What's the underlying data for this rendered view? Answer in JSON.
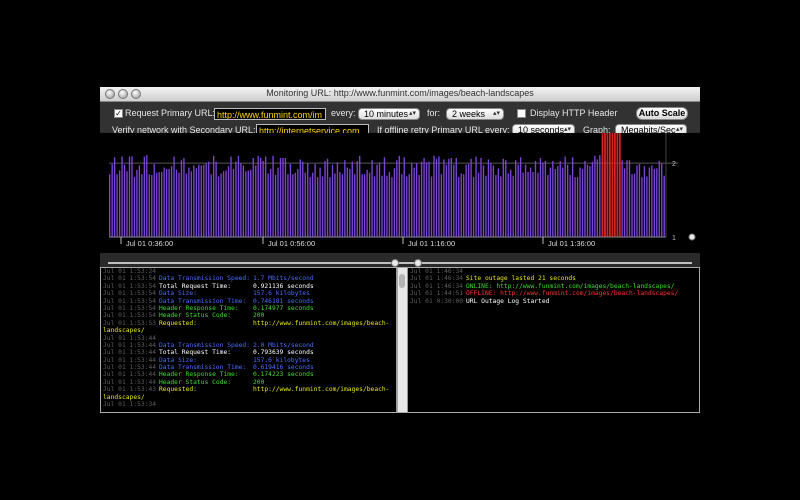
{
  "window": {
    "title": "Monitoring URL: http://www.funmint.com/images/beach-landscapes"
  },
  "controls": {
    "request_primary_checked": "✓",
    "request_primary_label": "Request Primary URL:",
    "primary_url": "http://www.funmint.com/im",
    "every_label": "every:",
    "every_value": "10 minutes",
    "for_label": "for:",
    "for_value": "2 weeks",
    "http_header_label": "Display HTTP Header",
    "auto_scale": "Auto Scale",
    "secondary_label": "Verify network with Secondary URL:",
    "secondary_url": "http://internetservice.com",
    "retry_label": "If offline retry Primary URL every:",
    "retry_value": "10 seconds",
    "graph_label": "Graph:",
    "graph_value": "Megabits/Sec"
  },
  "colors": {
    "bar": "#7b44d8",
    "outage": "#d8231e",
    "text_green": "#3fdc2f",
    "text_blue": "#4a6bff",
    "text_white": "#ffffff",
    "text_yellow": "#e6e619",
    "text_red": "#ff3030",
    "timestamp": "#5e5e5e"
  },
  "chart_data": {
    "type": "bar",
    "y_ticks": [
      "2",
      "1"
    ],
    "x_ticks": [
      "Jul 01 0:36:00",
      "Jul 01 0:56:00",
      "Jul 01 1:16:00",
      "Jul 01 1:36:00"
    ],
    "series": [
      {
        "values": [
          1.85,
          1.99,
          2.08,
          1.85,
          1.9,
          2.09,
          1.98,
          1.89,
          2.09,
          2.09,
          1.81,
          1.91,
          1.97,
          1.85,
          2.09,
          2.11,
          1.85,
          1.84,
          1.99,
          1.87,
          1.88,
          1.88,
          1.94,
          1.92,
          1.92,
          1.96,
          2.09,
          1.91,
          1.87,
          2.04,
          2.07,
          1.86,
          1.94,
          1.89,
          1.97,
          1.93,
          1.98,
          1.97,
          1.98,
          2.0,
          2.02,
          1.85,
          2.1,
          2.02,
          1.82,
          1.86,
          1.89,
          1.9,
          1.96,
          2.09,
          1.92,
          2.02,
          2.1,
          2.0,
          1.97,
          1.89,
          1.9,
          1.91,
          2.07,
          1.97,
          2.1,
          2.07,
          2.03,
          2.09,
          1.86,
          1.92,
          2.1,
          1.84,
          1.94,
          2.07,
          2.07,
          2.07,
          1.85,
          1.99,
          1.85,
          1.87,
          1.92,
          2.05,
          2.02,
          1.87,
          2.0,
          1.81,
          1.87,
          1.99,
          1.81,
          1.94,
          1.82,
          2.03,
          2.06,
          1.81,
          1.98,
          1.86,
          2.01,
          1.88,
          1.85,
          2.04,
          1.94,
          1.92,
          2.02,
          1.85,
          2.03,
          2.1,
          1.85,
          1.85,
          1.91,
          1.87,
          2.04,
          1.82,
          1.98,
          2.01,
          1.83,
          2.08,
          1.83,
          1.88,
          1.81,
          1.93,
          2.04,
          2.1,
          1.85,
          2.08,
          1.82,
          1.85,
          2.0,
          1.94,
          2.0,
          1.84,
          2.02,
          2.07,
          2.01,
          2.02,
          1.82,
          2.1,
          2.06,
          2.09,
          1.85,
          2.05,
          1.98,
          2.06,
          2.07,
          1.98,
          2.07,
          1.81,
          1.86,
          1.85,
          1.98,
          1.99,
          2.06,
          1.81,
          2.09,
          1.87,
          2.07,
          1.97,
          1.83,
          2.05,
          2.0,
          1.97,
          1.84,
          1.93,
          1.82,
          2.06,
          2.04,
          1.86,
          1.91,
          1.83,
          2.04,
          1.98,
          2.08,
          1.87,
          1.98,
          1.88,
          1.94,
          1.88,
          2.03,
          1.87,
          2.07,
          2.01,
          2.03,
          1.84,
          1.94,
          2.03,
          1.92,
          1.96,
          2.03,
          1.94,
          2.09,
          1.98,
          1.84,
          2.08,
          1.81,
          1.81,
          1.94,
          1.92,
          2.03,
          1.98,
          1.96,
          2.02,
          2.1,
          2.05,
          2.11,
          2.07,
          2.05,
          2.04,
          1.82,
          1.98,
          2.06,
          2.08,
          1.98,
          2.04,
          1.93,
          2.04,
          2.04,
          1.85,
          1.86,
          1.97,
          1.99,
          1.81,
          1.96,
          1.82,
          1.94,
          1.97,
          1.92,
          1.93,
          2.03,
          2.0,
          1.83
        ]
      },
      {
        "name": "Site outage",
        "start_index": 199,
        "length": 8
      }
    ]
  },
  "left_log": {
    "lines": [
      {
        "ts": "Jul 01 1:53:24",
        "k": "",
        "v": "",
        "kc": "text_green",
        "vc": "text_green"
      },
      {
        "ts": "Jul 01 1:53:54",
        "k": "Data Transmission Speed:",
        "v": "1.7 Mbits/second",
        "kc": "text_blue",
        "vc": "text_blue"
      },
      {
        "ts": "Jul 01 1:53:54",
        "k": "Total Request Time:",
        "v": "0.921136 seconds",
        "kc": "text_white",
        "vc": "text_white"
      },
      {
        "ts": "Jul 01 1:53:54",
        "k": "Data Size:",
        "v": "157.6 kilobytes",
        "kc": "text_blue",
        "vc": "text_blue"
      },
      {
        "ts": "Jul 01 1:53:54",
        "k": "Data Transmission Time:",
        "v": "0.746181 seconds",
        "kc": "text_blue",
        "vc": "text_blue"
      },
      {
        "ts": "Jul 01 1:53:54",
        "k": "Header Response Time:",
        "v": "0.174977 seconds",
        "kc": "text_green",
        "vc": "text_green"
      },
      {
        "ts": "Jul 01 1:53:54",
        "k": "Header Status Code:",
        "v": "200",
        "kc": "text_green",
        "vc": "text_green"
      },
      {
        "ts": "Jul 01 1:53:53",
        "k": "Requested:",
        "v": "http://www.funmint.com/images/beach-",
        "kc": "text_yellow",
        "vc": "text_yellow"
      },
      {
        "ts": "",
        "cont": "landscapes/",
        "kc": "text_yellow"
      },
      {
        "ts": "Jul 01 1:53:44",
        "k": "",
        "v": ""
      },
      {
        "ts": "Jul 01 1:53:44",
        "k": "Data Transmission Speed:",
        "v": "2.0 Mbits/second",
        "kc": "text_blue",
        "vc": "text_blue"
      },
      {
        "ts": "Jul 01 1:53:44",
        "k": "Total Request Time:",
        "v": "0.793639 seconds",
        "kc": "text_white",
        "vc": "text_white"
      },
      {
        "ts": "Jul 01 1:53:44",
        "k": "Data Size:",
        "v": "157.6 kilobytes",
        "kc": "text_blue",
        "vc": "text_blue"
      },
      {
        "ts": "Jul 01 1:53:44",
        "k": "Data Transmission Time:",
        "v": "0.619416 seconds",
        "kc": "text_blue",
        "vc": "text_blue"
      },
      {
        "ts": "Jul 01 1:53:44",
        "k": "Header Response Time:",
        "v": "0.174223 seconds",
        "kc": "text_green",
        "vc": "text_green"
      },
      {
        "ts": "Jul 01 1:53:44",
        "k": "Header Status Code:",
        "v": "200",
        "kc": "text_green",
        "vc": "text_green"
      },
      {
        "ts": "Jul 01 1:53:43",
        "k": "Requested:",
        "v": "http://www.funmint.com/images/beach-",
        "kc": "text_yellow",
        "vc": "text_yellow"
      },
      {
        "ts": "",
        "cont": "landscapes/",
        "kc": "text_yellow"
      },
      {
        "ts": "Jul 01 1:53:34",
        "k": "",
        "v": ""
      }
    ]
  },
  "right_log": {
    "lines": [
      {
        "ts": "Jul 01 1:46:34",
        "msg": "",
        "c": "text_white"
      },
      {
        "ts": "Jul 01 1:46:34",
        "msg": "Site outage lasted 21 seconds",
        "c": "text_yellow"
      },
      {
        "ts": "Jul 01 1:46:34",
        "msg": "ONLINE: http://www.funmint.com/images/beach-landscapes/",
        "c": "text_green"
      },
      {
        "ts": "Jul 01 1:44:51",
        "msg": "OFFLINE: http://www.funmint.com/images/beach-landscapes/",
        "c": "text_red"
      },
      {
        "ts": "Jul 01 0:30:00",
        "msg": "URL Outage Log Started",
        "c": "text_white"
      }
    ]
  }
}
